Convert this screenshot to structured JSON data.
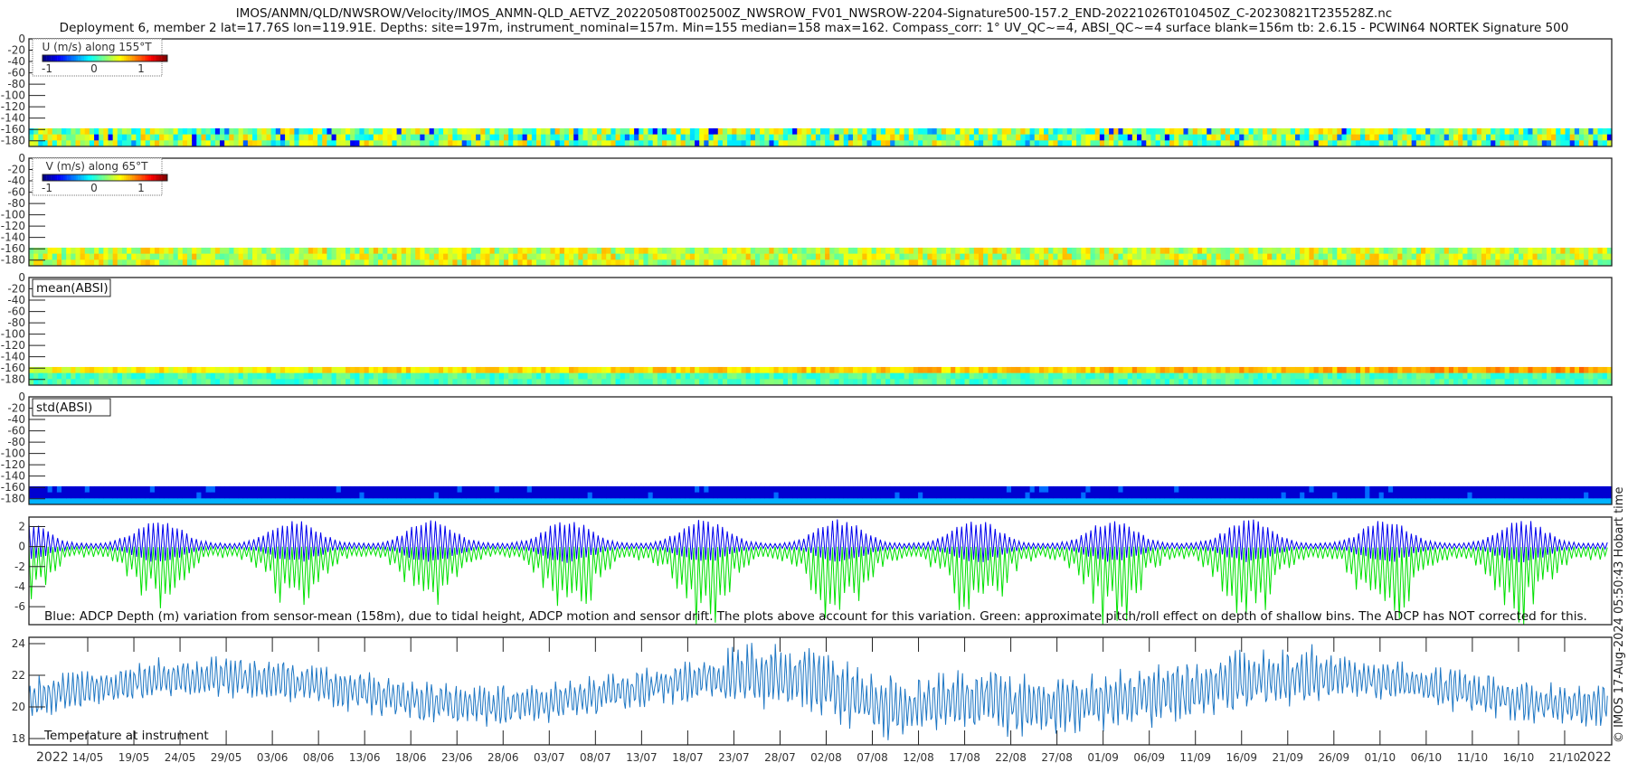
{
  "title": {
    "line1": "IMOS/ANMN/QLD/NWSROW/Velocity/IMOS_ANMN-QLD_AETVZ_20220508T002500Z_NWSROW_FV01_NWSROW-2204-Signature500-157.2_END-20221026T010450Z_C-20230821T235528Z.nc",
    "line2": "Deployment 6, member 2 lat=17.76S lon=119.91E. Depths: site=197m, instrument_nominal=157m. Min=155 median=158 max=162. Compass_corr: 1° UV_QC~=4, ABSI_QC~=4 surface blank=156m tb: 2.6.15 - PCWIN64 NORTEK Signature 500"
  },
  "side_label": "© IMOS 17-Aug-2024 05:50:43 Hobart time",
  "colors": {
    "blue_line": "#0000ee",
    "green_line": "#00e000",
    "temp_line": "#1f77c4"
  },
  "chart_data": [
    {
      "type": "heatmap",
      "name": "U",
      "legend_title": "U (m/s) along 155°T",
      "colorbar_ticks": [
        "-1",
        "0",
        "1"
      ],
      "clim": [
        -1.25,
        1.25
      ],
      "ylim": [
        -190,
        0
      ],
      "yticks": [
        "0",
        "-20",
        "-40",
        "-60",
        "-80",
        "-100",
        "-120",
        "-140",
        "-160",
        "-180"
      ],
      "data_depth_range": [
        -190,
        -158
      ],
      "typical_values": [
        -0.4,
        0.5
      ]
    },
    {
      "type": "heatmap",
      "name": "V",
      "legend_title": "V (m/s) along 65°T",
      "colorbar_ticks": [
        "-1",
        "0",
        "1"
      ],
      "clim": [
        -1.25,
        1.25
      ],
      "ylim": [
        -190,
        0
      ],
      "yticks": [
        "0",
        "-20",
        "-40",
        "-60",
        "-80",
        "-100",
        "-120",
        "-140",
        "-160",
        "-180"
      ],
      "data_depth_range": [
        -190,
        -158
      ],
      "typical_values": [
        -0.2,
        0.5
      ]
    },
    {
      "type": "heatmap",
      "name": "mean(ABSI)",
      "legend_title": "mean(ABSI)",
      "ylim": [
        -190,
        0
      ],
      "yticks": [
        "0",
        "-20",
        "-40",
        "-60",
        "-80",
        "-100",
        "-120",
        "-140",
        "-160",
        "-180"
      ],
      "data_depth_range": [
        -190,
        -158
      ]
    },
    {
      "type": "heatmap",
      "name": "std(ABSI)",
      "legend_title": "std(ABSI)",
      "ylim": [
        -190,
        0
      ],
      "yticks": [
        "0",
        "-20",
        "-40",
        "-60",
        "-80",
        "-100",
        "-120",
        "-140",
        "-160",
        "-180"
      ],
      "data_depth_range": [
        -190,
        -158
      ]
    },
    {
      "type": "line",
      "name": "depth variation",
      "ylim": [
        -7.8,
        2.95
      ],
      "yticks": [
        "2",
        "0",
        "-2",
        "-4",
        "-6"
      ],
      "annotation": "Blue: ADCP Depth (m) variation from sensor-mean (158m), due to tidal height, ADCP motion and sensor drift. The plots above account for this variation. Green: approximate pitch/roll effect on depth of shallow bins. The ADCP has NOT corrected for this.",
      "series": [
        {
          "name": "ADCP depth variation",
          "color": "blue",
          "range": [
            -2.5,
            2.7
          ]
        },
        {
          "name": "pitch/roll effect",
          "color": "green",
          "range": [
            -7.8,
            0
          ]
        }
      ]
    },
    {
      "type": "line",
      "name": "temperature",
      "ylim": [
        17.6,
        24.4
      ],
      "yticks": [
        "24",
        "22",
        "20",
        "18"
      ],
      "annotation": "Temperature at instrument",
      "series": [
        {
          "name": "Temperature",
          "range": [
            18,
            24.3
          ]
        }
      ]
    }
  ],
  "xaxis": {
    "start_date": "2022-05-07T14:00",
    "end_date": "2022-10-26",
    "year_left": "2022",
    "year_right": "2022",
    "ticks": [
      "14/05",
      "19/05",
      "24/05",
      "29/05",
      "03/06",
      "08/06",
      "13/06",
      "18/06",
      "23/06",
      "28/06",
      "03/07",
      "08/07",
      "13/07",
      "18/07",
      "23/07",
      "28/07",
      "02/08",
      "07/08",
      "12/08",
      "17/08",
      "22/08",
      "27/08",
      "01/09",
      "06/09",
      "11/09",
      "16/09",
      "21/09",
      "26/09",
      "01/10",
      "06/10",
      "11/10",
      "16/10",
      "21/10"
    ]
  }
}
